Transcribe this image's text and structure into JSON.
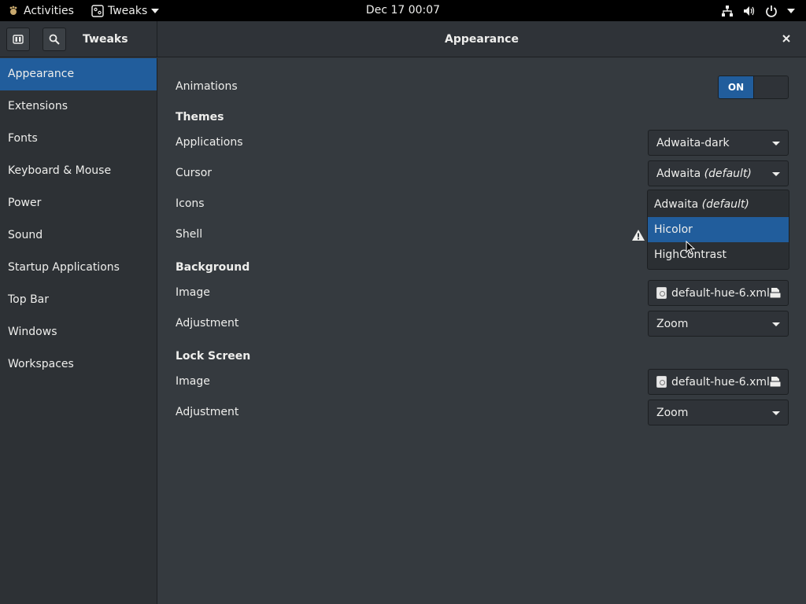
{
  "topbar": {
    "activities": "Activities",
    "app_menu": "Tweaks",
    "clock": "Dec 17  00:07",
    "icons": [
      "network-icon",
      "volume-icon",
      "power-icon",
      "chevron-down-icon"
    ]
  },
  "headerbar": {
    "left_title": "Tweaks",
    "title": "Appearance"
  },
  "sidebar": {
    "items": [
      {
        "label": "Appearance",
        "selected": true
      },
      {
        "label": "Extensions"
      },
      {
        "label": "Fonts"
      },
      {
        "label": "Keyboard & Mouse"
      },
      {
        "label": "Power"
      },
      {
        "label": "Sound"
      },
      {
        "label": "Startup Applications"
      },
      {
        "label": "Top Bar"
      },
      {
        "label": "Windows"
      },
      {
        "label": "Workspaces"
      }
    ]
  },
  "main": {
    "animations": {
      "label": "Animations",
      "state": "ON"
    },
    "themes": {
      "heading": "Themes",
      "applications_label": "Applications",
      "applications_value": "Adwaita-dark",
      "cursor_label": "Cursor",
      "cursor_value": "Adwaita",
      "cursor_value_suffix": "(default)",
      "icons_label": "Icons",
      "shell_label": "Shell"
    },
    "background": {
      "heading": "Background",
      "image_label": "Image",
      "image_value": "default-hue-6.xml",
      "adjustment_label": "Adjustment",
      "adjustment_value": "Zoom"
    },
    "lock_screen": {
      "heading": "Lock Screen",
      "image_label": "Image",
      "image_value": "default-hue-6.xml",
      "adjustment_label": "Adjustment",
      "adjustment_value": "Zoom"
    }
  },
  "popup": {
    "items": [
      {
        "label": "Adwaita",
        "suffix": "(default)"
      },
      {
        "label": "Hicolor",
        "highlighted": true
      },
      {
        "label": "HighContrast"
      }
    ]
  },
  "colors": {
    "accent": "#215d9c",
    "background": "#353a3f",
    "sidebar": "#2d3135"
  }
}
